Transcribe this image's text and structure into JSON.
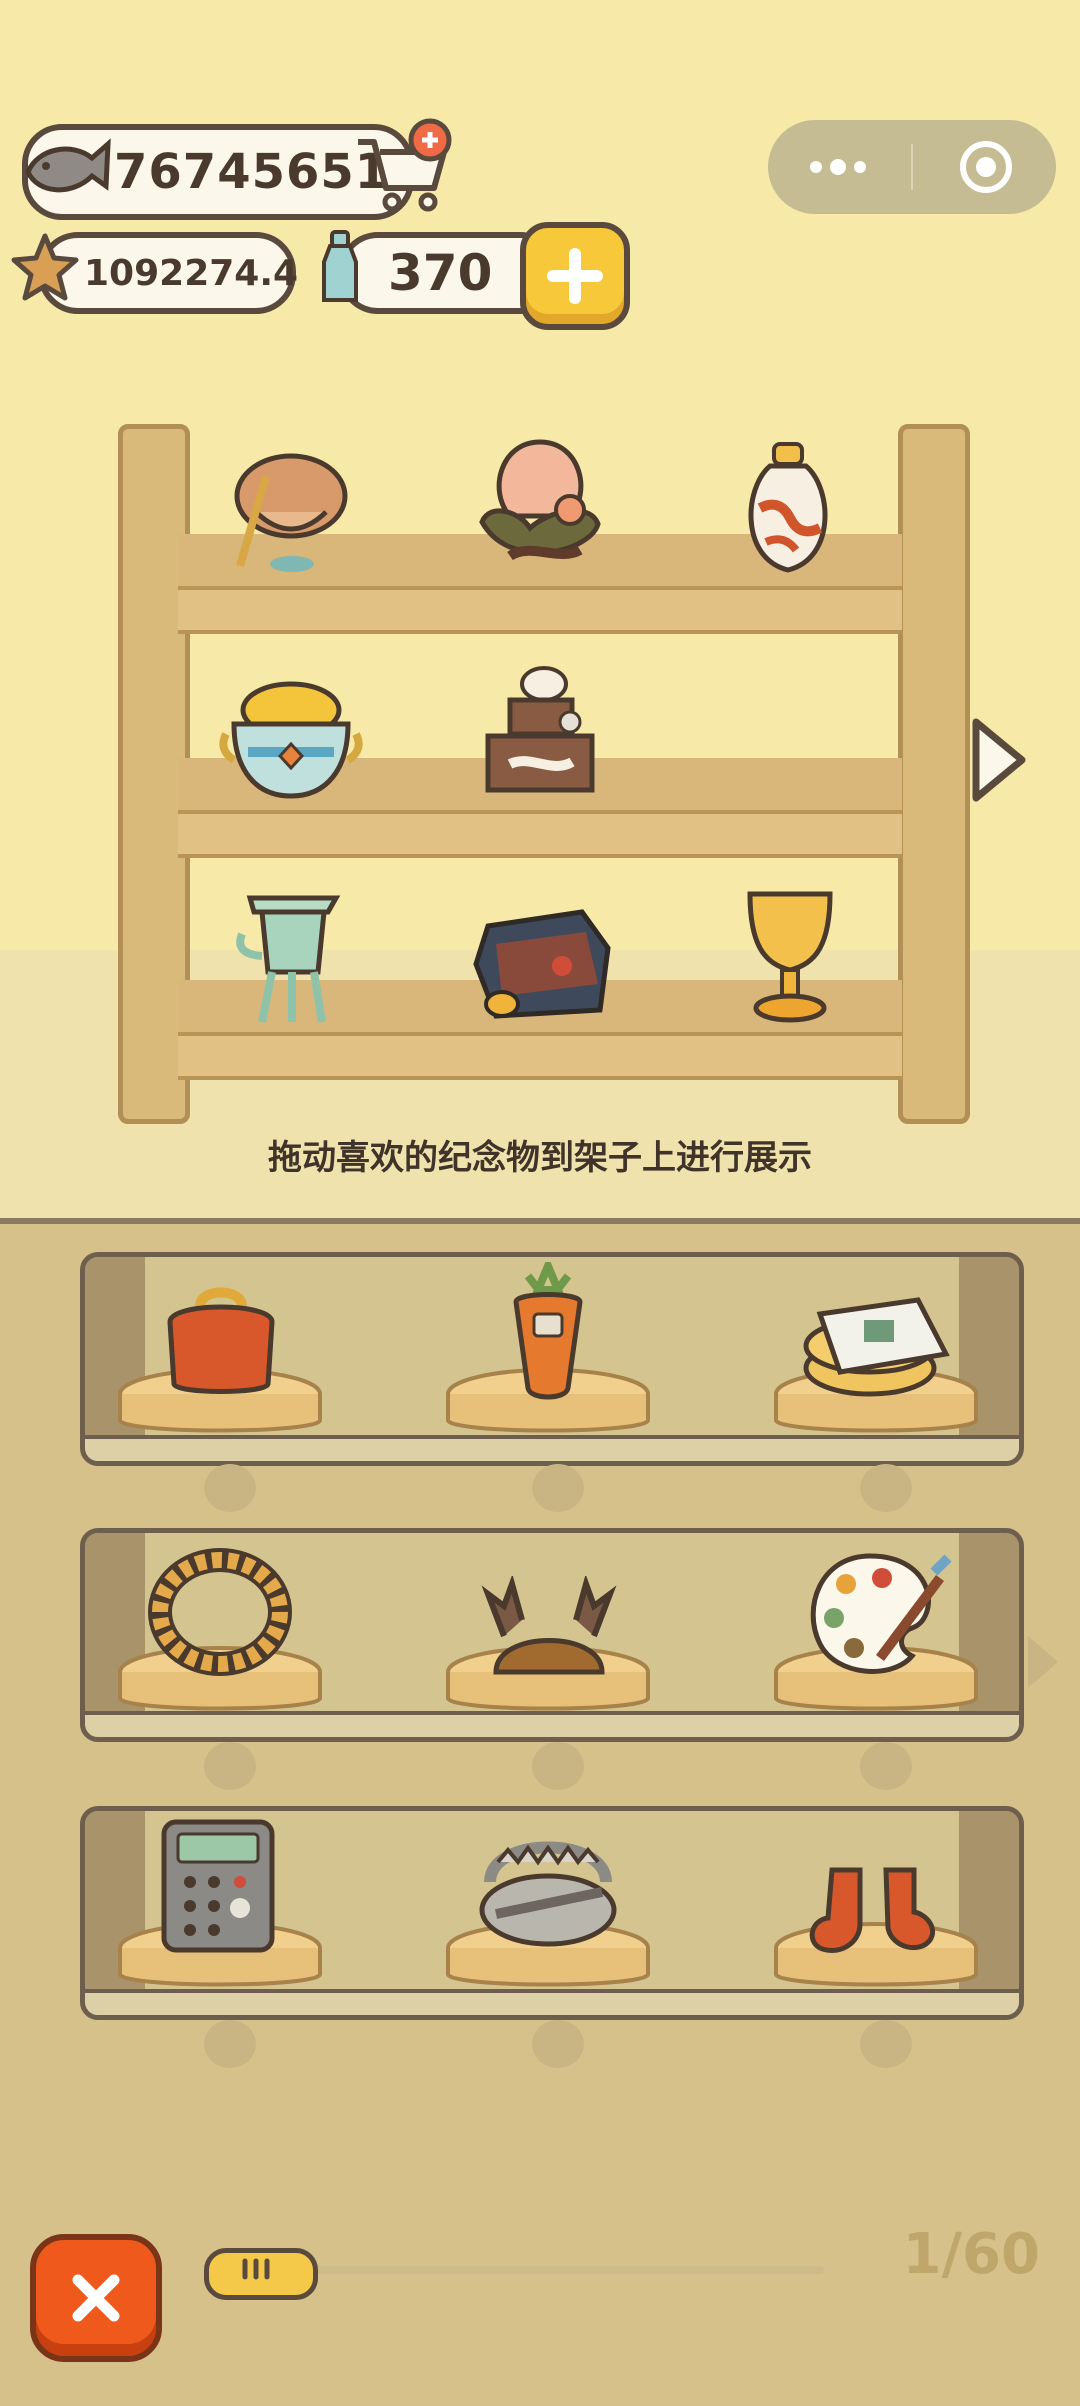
{
  "currencies": {
    "fish": "767456518",
    "star": "1092274.4",
    "bottle": "370"
  },
  "instruction": "拖动喜欢的纪念物到架子上进行展示",
  "pagination": {
    "text": "1/60"
  },
  "display_shelf": {
    "items": [
      {
        "name": "coin-pouch-souvenir"
      },
      {
        "name": "peach-bonsai-souvenir"
      },
      {
        "name": "painted-vase-souvenir"
      },
      {
        "name": "gold-bowl-souvenir"
      },
      {
        "name": "hamster-cake-souvenir"
      },
      {
        "name": "bronze-jue-souvenir"
      },
      {
        "name": "dark-stone-souvenir"
      },
      {
        "name": "golden-goblet-souvenir"
      }
    ]
  },
  "inventory": {
    "items": [
      "coin-purse",
      "carrot-phone",
      "cash-stack",
      "rope-wreath",
      "antler-hat",
      "paint-palette",
      "calculator",
      "bear-trap",
      "orange-socks"
    ]
  },
  "colors": {
    "accent_yellow": "#f7c83a",
    "close_orange": "#ef5a1c",
    "wood": "#d9ba7a"
  }
}
